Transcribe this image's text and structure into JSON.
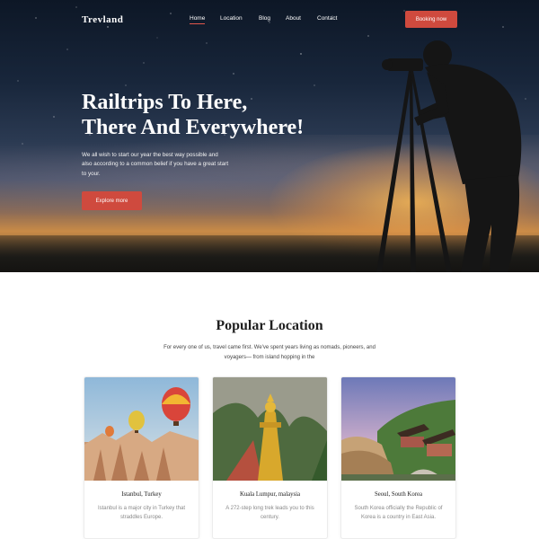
{
  "nav": {
    "logo": "Trevland",
    "links": [
      {
        "label": "Home",
        "active": true
      },
      {
        "label": "Location",
        "active": false
      },
      {
        "label": "Blog",
        "active": false
      },
      {
        "label": "About",
        "active": false
      },
      {
        "label": "Contact",
        "active": false
      }
    ],
    "booking_label": "Booking now"
  },
  "hero": {
    "title_line1": "Railtrips To Here,",
    "title_line2": "There And Everywhere!",
    "text": "We all wish to start our year the best way possible and also according to a common belief if you have a great start to your.",
    "button_label": "Explore more"
  },
  "popular": {
    "title": "Popular Location",
    "text": "For every one of us, travel came first. We've spent years living as nomads, pioneers, and voyagers— from island hopping in the",
    "cards": [
      {
        "title": "Istanbul, Turkey",
        "desc": "Istanbul is a major city in Turkey that straddles Europe."
      },
      {
        "title": "Kuala Lumpur, malaysia",
        "desc": "A 272-step long trek leads you to this century."
      },
      {
        "title": "Seoul, South Korea",
        "desc": "South Korea officially the Republic of Korea is a country in East Asia."
      }
    ]
  },
  "colors": {
    "accent": "#cf4a3e",
    "hero_sky": "#18263b",
    "sunset": "#c98b47"
  }
}
